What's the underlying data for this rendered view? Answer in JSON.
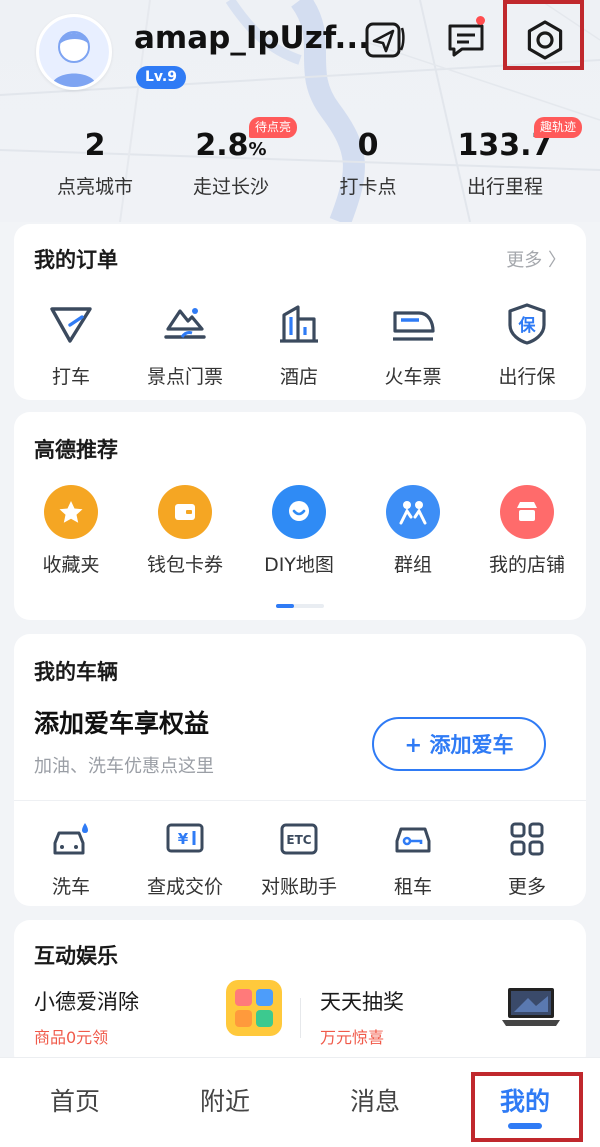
{
  "header": {
    "username": "amap_IpUzf...",
    "level": "Lv.9"
  },
  "stats": [
    {
      "value": "2",
      "unit": "",
      "label": "点亮城市",
      "tag": ""
    },
    {
      "value": "2.8",
      "unit": "%",
      "label": "走过长沙",
      "tag": "待点亮"
    },
    {
      "value": "0",
      "unit": "",
      "label": "打卡点",
      "tag": ""
    },
    {
      "value": "133.7",
      "unit": "",
      "label": "出行里程",
      "tag": "趣轨迹"
    }
  ],
  "orders": {
    "title": "我的订单",
    "more": "更多",
    "items": [
      {
        "label": "打车",
        "icon": "taxi-icon"
      },
      {
        "label": "景点门票",
        "icon": "scenic-ticket-icon"
      },
      {
        "label": "酒店",
        "icon": "hotel-icon"
      },
      {
        "label": "火车票",
        "icon": "train-icon"
      },
      {
        "label": "出行保",
        "icon": "insurance-icon"
      }
    ]
  },
  "recommend": {
    "title": "高德推荐",
    "items": [
      {
        "label": "收藏夹",
        "icon": "star-icon",
        "color": "#f5a623"
      },
      {
        "label": "钱包卡券",
        "icon": "wallet-icon",
        "color": "#f5a623"
      },
      {
        "label": "DIY地图",
        "icon": "smile-pin-icon",
        "color": "#2f8bf5"
      },
      {
        "label": "群组",
        "icon": "group-icon",
        "color": "#3d8ef6"
      },
      {
        "label": "我的店铺",
        "icon": "shop-icon",
        "color": "#ff6b6b"
      }
    ]
  },
  "vehicle": {
    "title": "我的车辆",
    "headline": "添加爱车享权益",
    "subtitle": "加油、洗车优惠点这里",
    "button": "+ 添加爱车",
    "items": [
      {
        "label": "洗车",
        "icon": "car-wash-icon"
      },
      {
        "label": "查成交价",
        "icon": "price-icon"
      },
      {
        "label": "对账助手",
        "icon": "etc-icon"
      },
      {
        "label": "租车",
        "icon": "car-rental-icon"
      },
      {
        "label": "更多",
        "icon": "grid-more-icon"
      }
    ]
  },
  "entertainment": {
    "title": "互动娱乐",
    "left": {
      "title": "小德爱消除",
      "sub": "商品0元领"
    },
    "right": {
      "title": "天天抽奖",
      "sub": "万元惊喜"
    }
  },
  "tabs": [
    {
      "label": "首页"
    },
    {
      "label": "附近"
    },
    {
      "label": "消息"
    },
    {
      "label": "我的"
    }
  ],
  "colors": {
    "accent": "#2f7bf5",
    "highlight": "#c0282d",
    "tag": "#ff5a5a"
  }
}
